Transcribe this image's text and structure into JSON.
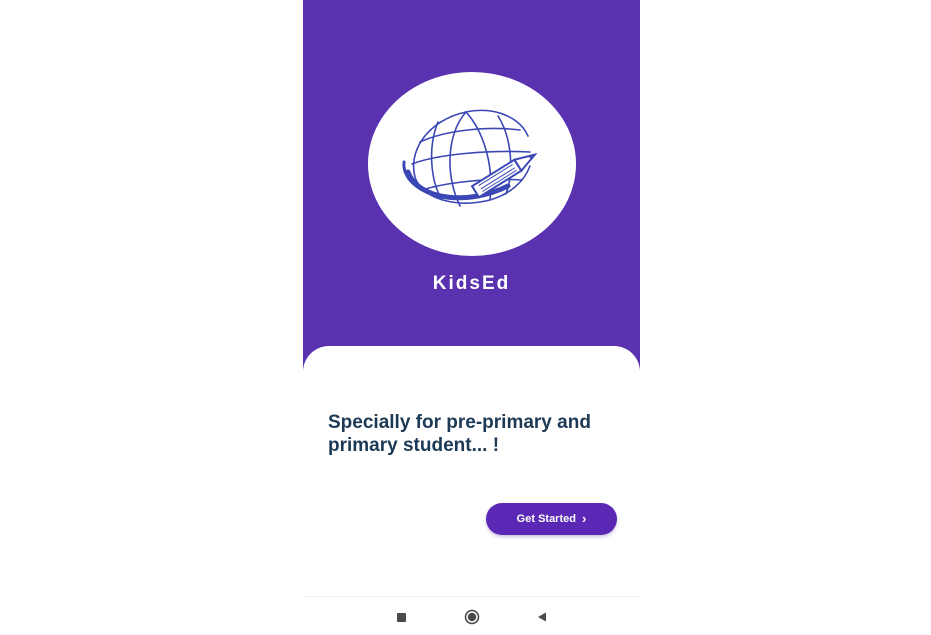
{
  "app": {
    "name": "KidsEd",
    "logo_icon": "globe-pencil-icon"
  },
  "onboarding": {
    "tagline": "Specially for pre-primary and primary student... !",
    "cta_label": "Get Started",
    "cta_icon": "chevron-right-icon"
  },
  "nav": {
    "recent_icon": "square-icon",
    "home_icon": "circle-icon",
    "back_icon": "triangle-back-icon"
  },
  "colors": {
    "primary": "#5a32b0",
    "button": "#5a28b4",
    "tagline_text": "#1c3a55",
    "surface": "#ffffff"
  }
}
